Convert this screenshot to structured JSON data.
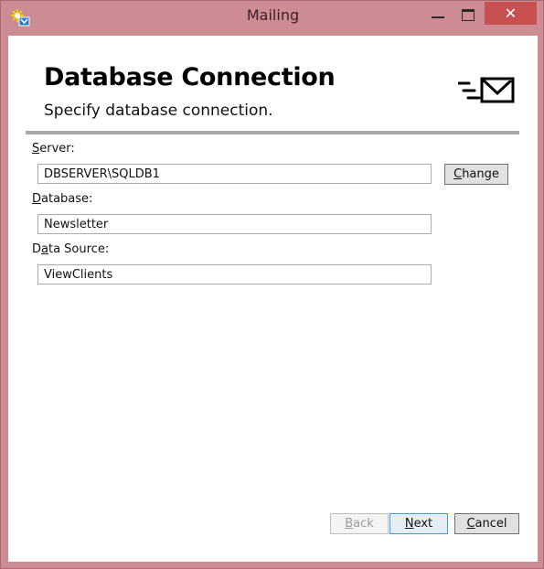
{
  "window": {
    "title": "Mailing",
    "icons": {
      "app": "sun-mail-icon",
      "minimize": "minimize-icon",
      "maximize": "maximize-icon",
      "close": "close-icon",
      "close_glyph": "✕"
    }
  },
  "header": {
    "title": "Database Connection",
    "subtitle": "Specify database connection.",
    "logo": "mail-send-icon"
  },
  "form": {
    "server": {
      "label_mnemonic": "S",
      "label_rest": "erver:",
      "value": "DBSERVER\\SQLDB1",
      "change_button": {
        "mnemonic": "C",
        "rest": "hange"
      }
    },
    "database": {
      "label_mnemonic": "D",
      "label_rest": "atabase:",
      "value": "Newsletter"
    },
    "data_source": {
      "label_pre": "D",
      "label_mnemonic": "a",
      "label_rest": "ta Source:",
      "value": "ViewClients"
    }
  },
  "footer": {
    "back": {
      "mnemonic": "B",
      "rest": "ack",
      "enabled": false
    },
    "next": {
      "mnemonic": "N",
      "rest": "ext",
      "enabled": true
    },
    "cancel": {
      "mnemonic": "C",
      "rest": "ancel",
      "enabled": true
    }
  },
  "colors": {
    "frame": "#cd8b93",
    "close_button": "#c75050",
    "separator": "#a9a9a9",
    "default_button_border": "#3c9ae8"
  }
}
